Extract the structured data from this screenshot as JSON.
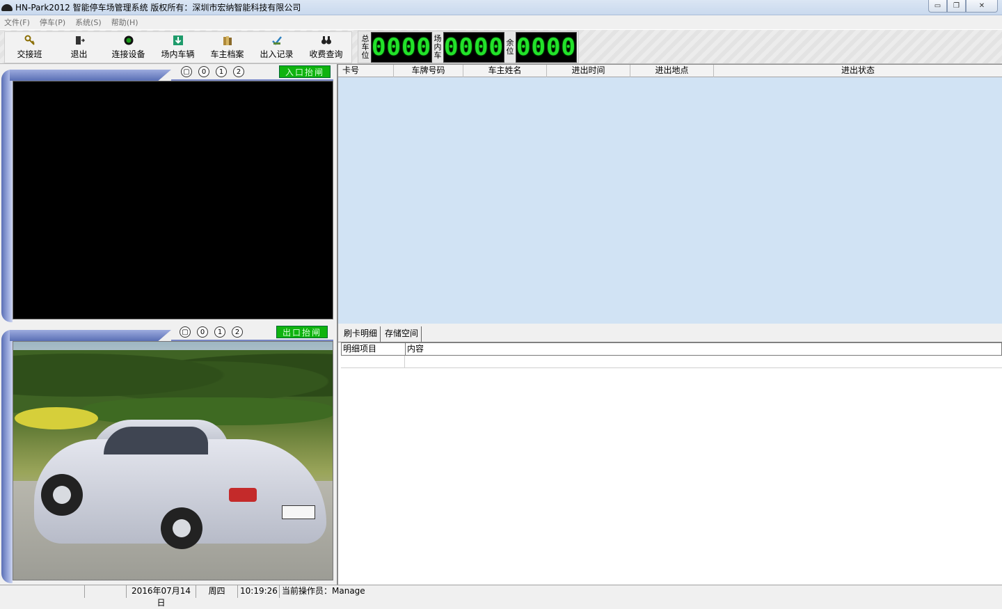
{
  "window": {
    "title": "HN-Park2012 智能停车场管理系统 版权所有：深圳市宏纳智能科技有限公司",
    "min_glyph": "▭",
    "restore_glyph": "❐",
    "close_glyph": "✕"
  },
  "menu": [
    {
      "label": "文件(F)"
    },
    {
      "label": "停车(P)"
    },
    {
      "label": "系统(S)"
    },
    {
      "label": "帮助(H)"
    }
  ],
  "toolbar": {
    "buttons": [
      {
        "label": "交接班",
        "icon": "key-icon"
      },
      {
        "label": "退出",
        "icon": "exit-door-icon"
      },
      {
        "label": "连接设备",
        "icon": "connect-icon"
      },
      {
        "label": "场内车辆",
        "icon": "vehicles-icon"
      },
      {
        "label": "车主档案",
        "icon": "archive-icon"
      },
      {
        "label": "出入记录",
        "icon": "records-icon"
      },
      {
        "label": "收费查询",
        "icon": "binoculars-icon"
      }
    ],
    "counters": [
      {
        "label": "总车位",
        "value": "0000"
      },
      {
        "label": "场内车",
        "value": "0000"
      },
      {
        "label": "余位",
        "value": "0000"
      }
    ]
  },
  "entry_panel": {
    "controls": [
      "▢",
      "0",
      "1",
      "2"
    ],
    "gate_button": "入口抬闸"
  },
  "exit_panel": {
    "controls": [
      "▢",
      "0",
      "1",
      "2"
    ],
    "gate_button": "出口抬闸"
  },
  "records_table": {
    "headers": [
      "卡号",
      "车牌号码",
      "车主姓名",
      "进出时间",
      "进出地点",
      "进出状态"
    ]
  },
  "tabs": [
    {
      "label": "刷卡明细"
    },
    {
      "label": "存储空间"
    }
  ],
  "detail_table": {
    "headers": [
      "明细项目",
      "内容"
    ]
  },
  "status": {
    "date": "2016年07月14日",
    "weekday": "周四",
    "time": "10:19:26",
    "operator": "当前操作员：Manage"
  },
  "colors": {
    "led_green": "#22e22a",
    "gate_button_green": "#0fb30f",
    "grid_background": "#d1e3f4"
  }
}
